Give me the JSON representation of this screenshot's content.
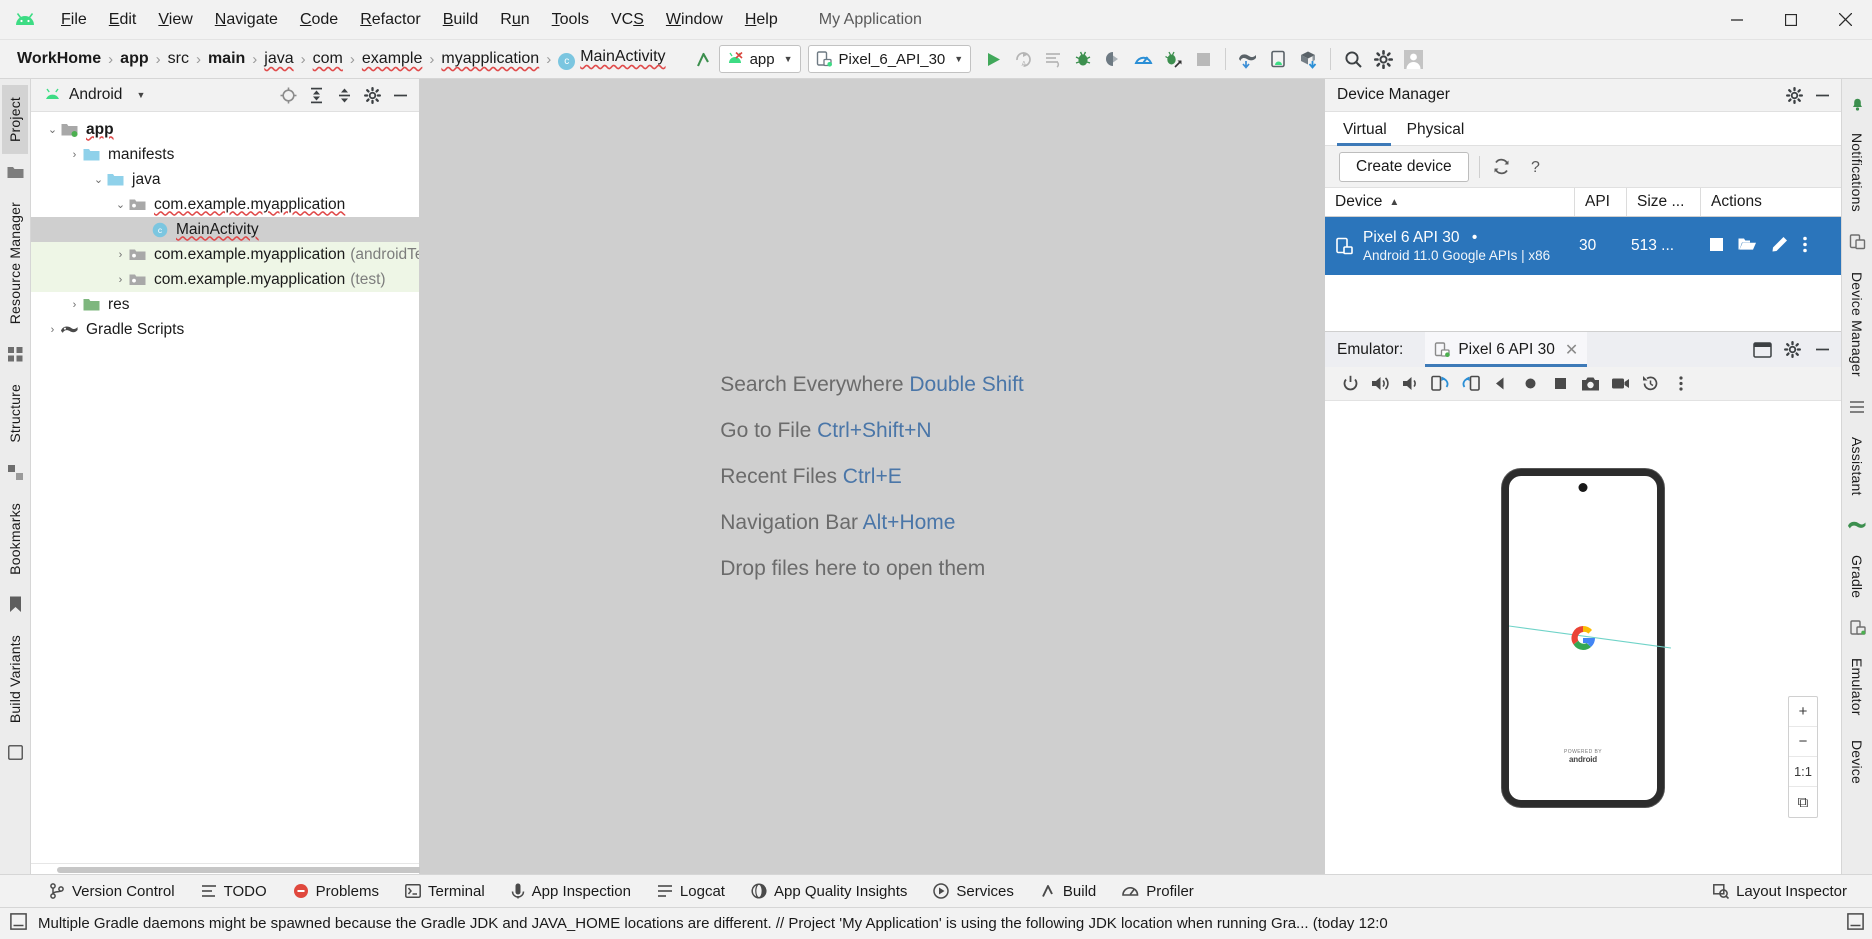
{
  "window": {
    "app_title": "My Application",
    "minimize": "─",
    "maximize": "☐",
    "close": "✕"
  },
  "menubar": {
    "items": [
      {
        "label": "File",
        "mnemonic": "F"
      },
      {
        "label": "Edit",
        "mnemonic": "E"
      },
      {
        "label": "View",
        "mnemonic": "V"
      },
      {
        "label": "Navigate",
        "mnemonic": "N"
      },
      {
        "label": "Code",
        "mnemonic": "C"
      },
      {
        "label": "Refactor",
        "mnemonic": "R"
      },
      {
        "label": "Build",
        "mnemonic": "B"
      },
      {
        "label": "Run",
        "mnemonic": "u"
      },
      {
        "label": "Tools",
        "mnemonic": "T"
      },
      {
        "label": "VCS",
        "mnemonic": "S"
      },
      {
        "label": "Window",
        "mnemonic": "W"
      },
      {
        "label": "Help",
        "mnemonic": "H"
      }
    ]
  },
  "navbar": {
    "breadcrumbs": [
      {
        "label": "WorkHome",
        "bold": true
      },
      {
        "label": "app",
        "bold": true
      },
      {
        "label": "src",
        "bold": false
      },
      {
        "label": "main",
        "bold": true
      },
      {
        "label": "java",
        "bold": false
      },
      {
        "label": "com",
        "bold": false
      },
      {
        "label": "example",
        "bold": false
      },
      {
        "label": "myapplication",
        "bold": false
      },
      {
        "label": "MainActivity",
        "bold": false,
        "icon": "class-icon",
        "icon_letter": "c"
      }
    ],
    "separator": "›",
    "run_config": {
      "label": "app",
      "caret": "▼"
    },
    "device_target": {
      "label": "Pixel_6_API_30",
      "caret": "▼"
    },
    "actions": [
      "run-icon",
      "apply-changes-icon",
      "apply-code-changes-icon",
      "debug-icon",
      "attach-debugger-icon",
      "profiler-icon",
      "run-with-coverage-icon",
      "stop-icon"
    ],
    "right_actions": [
      "gradle-sync-icon",
      "avd-manager-icon",
      "sdk-manager-icon",
      "search-icon",
      "settings-icon",
      "account-icon"
    ]
  },
  "left_strip": {
    "tabs": [
      {
        "label": "Project",
        "active": true
      },
      {
        "label": "Resource Manager",
        "active": false
      },
      {
        "label": "Structure",
        "active": false
      },
      {
        "label": "Bookmarks",
        "active": false
      },
      {
        "label": "Build Variants",
        "active": false
      }
    ]
  },
  "right_strip": {
    "tabs": [
      {
        "label": "Notifications"
      },
      {
        "label": "Device Manager"
      },
      {
        "label": "Assistant"
      },
      {
        "label": "Gradle"
      },
      {
        "label": "Emulator"
      },
      {
        "label": "Device"
      }
    ]
  },
  "project_panel": {
    "title": "Android",
    "caret": "▼",
    "actions": [
      "select-opened-file-icon",
      "expand-all-icon",
      "collapse-all-icon",
      "settings-icon",
      "hide-icon"
    ],
    "tree": [
      {
        "indent": 0,
        "arrow": "⌄",
        "icon": "module-icon",
        "label": "app",
        "bold": true,
        "sublabel": "",
        "selected": false,
        "test": false
      },
      {
        "indent": 1,
        "arrow": "›",
        "icon": "folder-icon",
        "label": "manifests",
        "bold": false,
        "sublabel": "",
        "selected": false,
        "test": false
      },
      {
        "indent": 1,
        "arrow": "⌄",
        "icon": "folder-icon",
        "label": "java",
        "bold": false,
        "sublabel": "",
        "selected": false,
        "test": false
      },
      {
        "indent": 2,
        "arrow": "⌄",
        "icon": "package-icon",
        "label": "com.example.myapplication",
        "bold": false,
        "sublabel": "",
        "selected": false,
        "test": false
      },
      {
        "indent": 3,
        "arrow": "",
        "icon": "class-icon",
        "label": "MainActivity",
        "bold": false,
        "sublabel": "",
        "selected": true,
        "test": false
      },
      {
        "indent": 2,
        "arrow": "›",
        "icon": "package-icon",
        "label": "com.example.myapplication",
        "bold": false,
        "sublabel": "(androidTest)",
        "selected": false,
        "test": true
      },
      {
        "indent": 2,
        "arrow": "›",
        "icon": "package-icon",
        "label": "com.example.myapplication",
        "bold": false,
        "sublabel": "(test)",
        "selected": false,
        "test": true
      },
      {
        "indent": 1,
        "arrow": "›",
        "icon": "res-folder-icon",
        "label": "res",
        "bold": false,
        "sublabel": "",
        "selected": false,
        "test": false
      },
      {
        "indent": 0,
        "arrow": "›",
        "icon": "gradle-icon",
        "label": "Gradle Scripts",
        "bold": false,
        "sublabel": "",
        "selected": false,
        "test": false
      }
    ]
  },
  "editor": {
    "tips": [
      {
        "text": "Search Everywhere ",
        "key": "Double Shift"
      },
      {
        "text": "Go to File ",
        "key": "Ctrl+Shift+N"
      },
      {
        "text": "Recent Files ",
        "key": "Ctrl+E"
      },
      {
        "text": "Navigation Bar ",
        "key": "Alt+Home"
      },
      {
        "text": "Drop files here to open them",
        "key": ""
      }
    ]
  },
  "device_manager": {
    "title": "Device Manager",
    "head_actions": [
      "settings-icon",
      "hide-icon"
    ],
    "tabs": [
      {
        "label": "Virtual",
        "active": true
      },
      {
        "label": "Physical",
        "active": false
      }
    ],
    "create_device_label": "Create device",
    "refresh_icon": "refresh-icon",
    "help_icon": "help-icon",
    "columns": [
      {
        "label": "Device",
        "sort": "▲"
      },
      {
        "label": "API",
        "sort": ""
      },
      {
        "label": "Size ...",
        "sort": ""
      },
      {
        "label": "Actions",
        "sort": ""
      }
    ],
    "rows": [
      {
        "name": "Pixel 6 API 30",
        "running_dot": "•",
        "subtitle": "Android 11.0 Google APIs | x86",
        "api": "30",
        "size": "513 ...",
        "actions": [
          "stop-icon",
          "open-folder-icon",
          "edit-icon",
          "overflow-menu-icon"
        ],
        "selected": true
      }
    ]
  },
  "emulator": {
    "label": "Emulator:",
    "tab_name": "Pixel 6 API 30",
    "tab_close": "✕",
    "head_actions": [
      "split-view-icon",
      "settings-icon",
      "hide-icon"
    ],
    "toolbar": [
      "power-icon",
      "volume-up-icon",
      "volume-down-icon",
      "rotate-left-icon",
      "rotate-right-icon",
      "back-icon",
      "home-icon",
      "overview-icon",
      "screenshot-icon",
      "record-icon",
      "history-icon",
      "more-icon"
    ],
    "zoom_controls": [
      {
        "label": "+",
        "name": "zoom-in-button"
      },
      {
        "label": "−",
        "name": "zoom-out-button"
      },
      {
        "label": "1:1",
        "name": "zoom-actual-button"
      },
      {
        "label": "⧉",
        "name": "zoom-fit-button"
      }
    ],
    "screen": {
      "brand_top": "POWERED BY",
      "brand_bottom": "android"
    }
  },
  "bottom_bar": {
    "items": [
      {
        "label": "Version Control",
        "icon": "branch-icon"
      },
      {
        "label": "TODO",
        "icon": "todo-icon"
      },
      {
        "label": "Problems",
        "icon": "problems-icon"
      },
      {
        "label": "Terminal",
        "icon": "terminal-icon"
      },
      {
        "label": "App Inspection",
        "icon": "inspection-icon"
      },
      {
        "label": "Logcat",
        "icon": "logcat-icon"
      },
      {
        "label": "App Quality Insights",
        "icon": "quality-icon"
      },
      {
        "label": "Services",
        "icon": "services-icon"
      },
      {
        "label": "Build",
        "icon": "build-icon"
      },
      {
        "label": "Profiler",
        "icon": "profiler-icon"
      }
    ],
    "right_item": {
      "label": "Layout Inspector",
      "icon": "layout-inspector-icon"
    }
  },
  "status_bar": {
    "icon": "event-log-icon",
    "message": "Multiple Gradle daemons might be spawned because the Gradle JDK and JAVA_HOME locations are different. // Project 'My Application' is using the following JDK location when running Gra... (today 12:0",
    "right_icons": [
      "memory-icon"
    ]
  },
  "colors": {
    "accent_blue": "#2b75bb",
    "tab_underline": "#3d7ab8",
    "android_green": "#3ddc84",
    "link_blue": "#4a76a8",
    "error_red": "#e04a4a",
    "test_green_bg": "#eef6e6"
  }
}
